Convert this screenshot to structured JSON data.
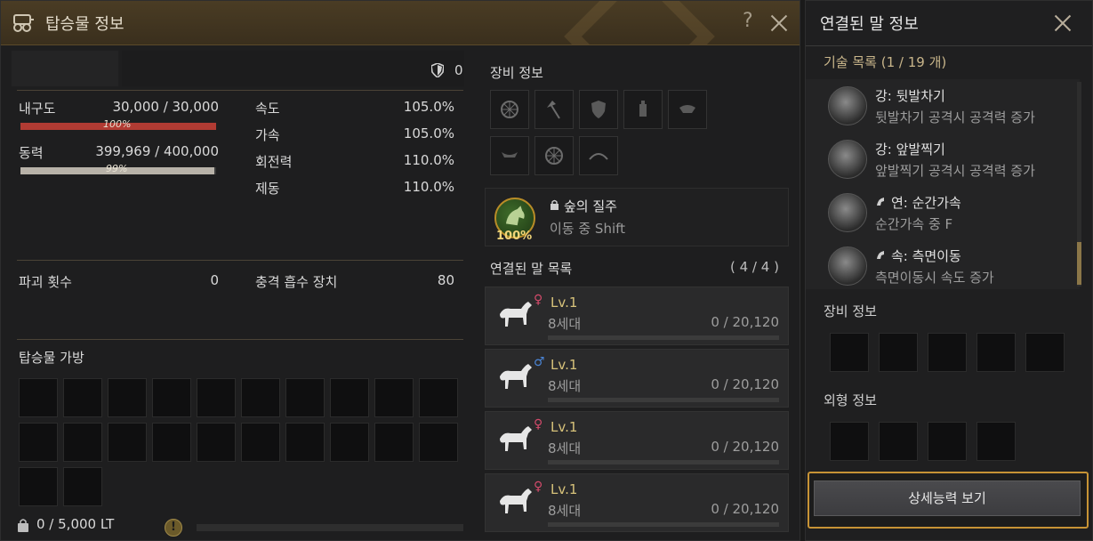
{
  "main_window": {
    "title": "탑승물 정보",
    "help": "?",
    "defense_value": "0",
    "stats": {
      "durability_label": "내구도",
      "durability_value": "30,000 / 30,000",
      "durability_pct": "100%",
      "durability_fraction": 1.0,
      "stamina_label": "동력",
      "stamina_value": "399,969 / 400,000",
      "stamina_pct": "99%",
      "stamina_fraction": 0.99,
      "speed_label": "속도",
      "speed_value": "105.0%",
      "accel_label": "가속",
      "accel_value": "105.0%",
      "turn_label": "회전력",
      "turn_value": "110.0%",
      "brake_label": "제동",
      "brake_value": "110.0%",
      "destroy_label": "파괴 횟수",
      "destroy_value": "0",
      "shock_label": "충격 흡수 장치",
      "shock_value": "80"
    },
    "inventory": {
      "title": "탑승물 가방",
      "weight": "0 / 5,000 LT",
      "weight_fraction": 0
    },
    "equipment": {
      "title": "장비 정보",
      "slots": [
        "wheel-icon",
        "axe-icon",
        "shield-icon",
        "lantern-icon",
        "figurehead-icon",
        "ornament-icon",
        "wheel-icon",
        "bow-icon"
      ]
    },
    "skill": {
      "name": "숲의 질주",
      "desc": "이동 중 Shift",
      "pct": "100%"
    },
    "horses": {
      "title": "연결된 말 목록",
      "count": "( 4 / 4 )",
      "items": [
        {
          "gender": "♀",
          "level": "Lv.1",
          "gen": "8세대",
          "exp": "0 / 20,120"
        },
        {
          "gender": "♂",
          "level": "Lv.1",
          "gen": "8세대",
          "exp": "0 / 20,120"
        },
        {
          "gender": "♀",
          "level": "Lv.1",
          "gen": "8세대",
          "exp": "0 / 20,120"
        },
        {
          "gender": "♀",
          "level": "Lv.1",
          "gen": "8세대",
          "exp": "0 / 20,120"
        }
      ]
    }
  },
  "right_window": {
    "title": "연결된 말 정보",
    "skills_title": "기술 목록 (1 / 19 개)",
    "skills": [
      {
        "name": "강: 뒷발차기",
        "desc": "뒷발차기 공격시 공격력 증가"
      },
      {
        "name": "강: 앞발찍기",
        "desc": "앞발찍기 공격시 공격력 증가"
      },
      {
        "name": "연: 순간가속",
        "desc": "순간가속 중 F"
      },
      {
        "name": "속: 측면이동",
        "desc": "측면이동시 속도 증가"
      }
    ],
    "equip_title": "장비 정보",
    "appearance_title": "외형 정보",
    "detail_button": "상세능력 보기"
  },
  "colors": {
    "accent_gold": "#c79335",
    "durability_red": "#b13b33",
    "stamina_gray": "#b8b2a8",
    "female": "#d24a6a",
    "male": "#4a84d4"
  }
}
